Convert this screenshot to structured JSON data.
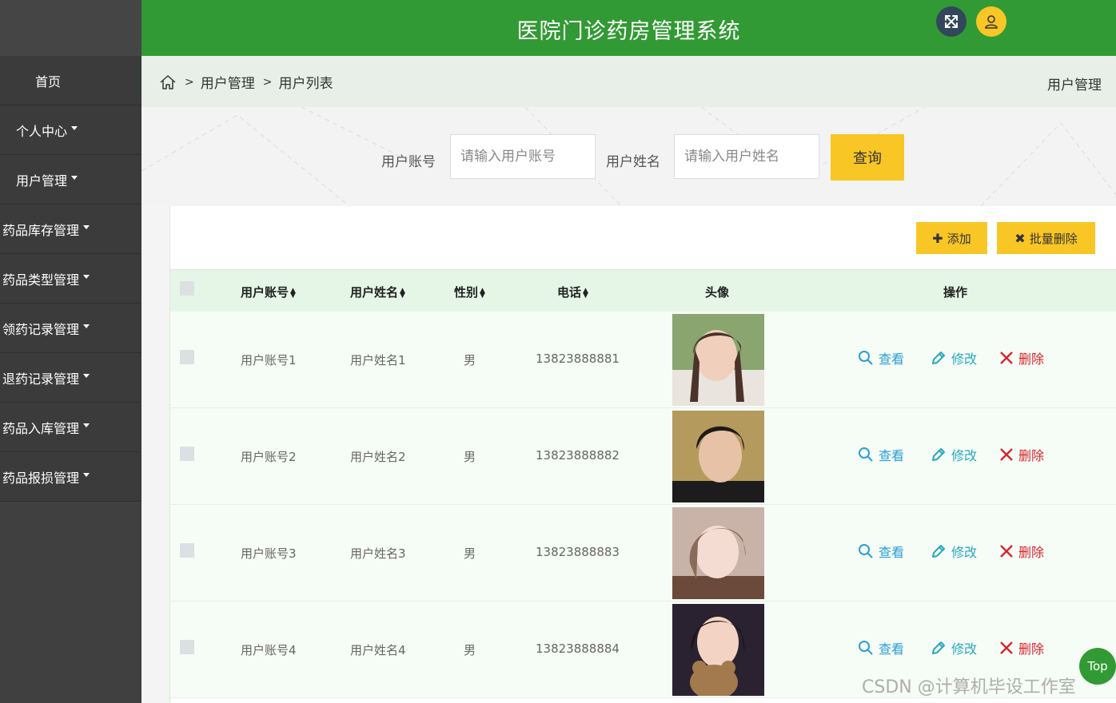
{
  "header": {
    "title": "医院门诊药房管理系统"
  },
  "sidebar": {
    "items": [
      {
        "label": "首页"
      },
      {
        "label": "个人中心"
      },
      {
        "label": "用户管理"
      },
      {
        "label": "药品库存管理"
      },
      {
        "label": "药品类型管理"
      },
      {
        "label": "领药记录管理"
      },
      {
        "label": "退药记录管理"
      },
      {
        "label": "药品入库管理"
      },
      {
        "label": "药品报损管理"
      }
    ]
  },
  "breadcrumb": {
    "sep": ">",
    "items": [
      "用户管理",
      "用户列表"
    ],
    "right": "用户管理"
  },
  "search": {
    "account_label": "用户账号",
    "account_placeholder": "请输入用户账号",
    "name_label": "用户姓名",
    "name_placeholder": "请输入用户姓名",
    "query_label": "查询"
  },
  "toolbar": {
    "add_label": "添加",
    "batch_delete_label": "批量删除"
  },
  "table": {
    "columns": [
      "用户账号",
      "用户姓名",
      "性别",
      "电话",
      "头像",
      "操作"
    ],
    "actions": {
      "view": "查看",
      "edit": "修改",
      "delete": "删除"
    },
    "rows": [
      {
        "account": "用户账号1",
        "name": "用户姓名1",
        "gender": "男",
        "phone": "13823888881"
      },
      {
        "account": "用户账号2",
        "name": "用户姓名2",
        "gender": "男",
        "phone": "13823888882"
      },
      {
        "account": "用户账号3",
        "name": "用户姓名3",
        "gender": "男",
        "phone": "13823888883"
      },
      {
        "account": "用户账号4",
        "name": "用户姓名4",
        "gender": "男",
        "phone": "13823888884"
      }
    ]
  },
  "back_to_top": "Top",
  "watermark": "CSDN @计算机毕设工作室",
  "colors": {
    "header_green": "#329a34",
    "accent_yellow": "#f8c625",
    "sidebar": "#3b3b3b"
  }
}
